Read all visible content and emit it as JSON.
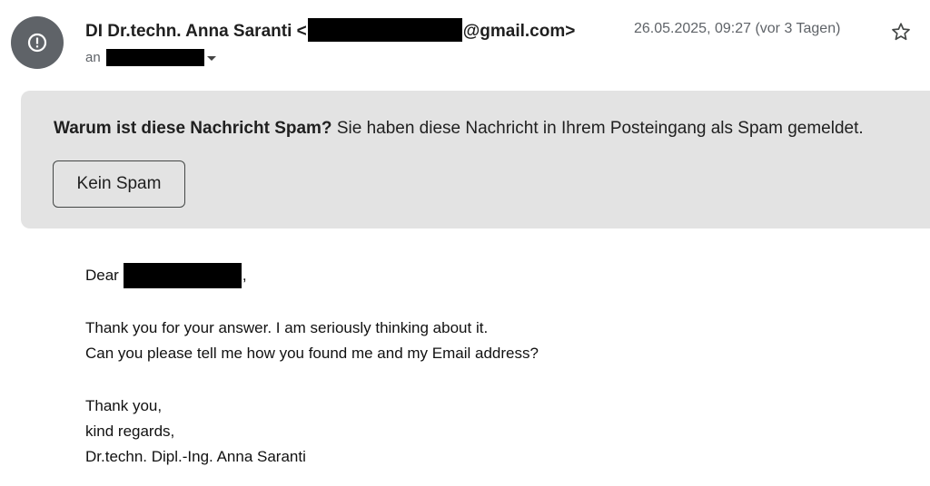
{
  "header": {
    "avatar_icon": "alert-circle-icon",
    "sender_name": "DI Dr.techn. Anna Saranti <",
    "sender_email_suffix": "@gmail.com>",
    "date": "26.05.2025, 09:27 (vor 3 Tagen)",
    "to_label": "an",
    "star_icon": "star-outline-icon"
  },
  "spam_banner": {
    "question": "Warum ist diese Nachricht Spam?",
    "reason": " Sie haben diese Nachricht in Ihrem Posteingang als Spam gemeldet.",
    "button_label": "Kein Spam"
  },
  "body": {
    "greeting": "Dear",
    "greeting_punct": ",",
    "line1": "Thank you for your answer. I am seriously thinking about it.",
    "line2": "Can you please tell me how you found me and my Email address?",
    "closing1": "Thank you,",
    "closing2": "kind regards,",
    "signature": "Dr.techn. Dipl.-Ing. Anna Saranti"
  },
  "colors": {
    "avatar_bg": "#5f6368",
    "banner_bg": "#e3e3e3",
    "redaction": "#000000"
  }
}
